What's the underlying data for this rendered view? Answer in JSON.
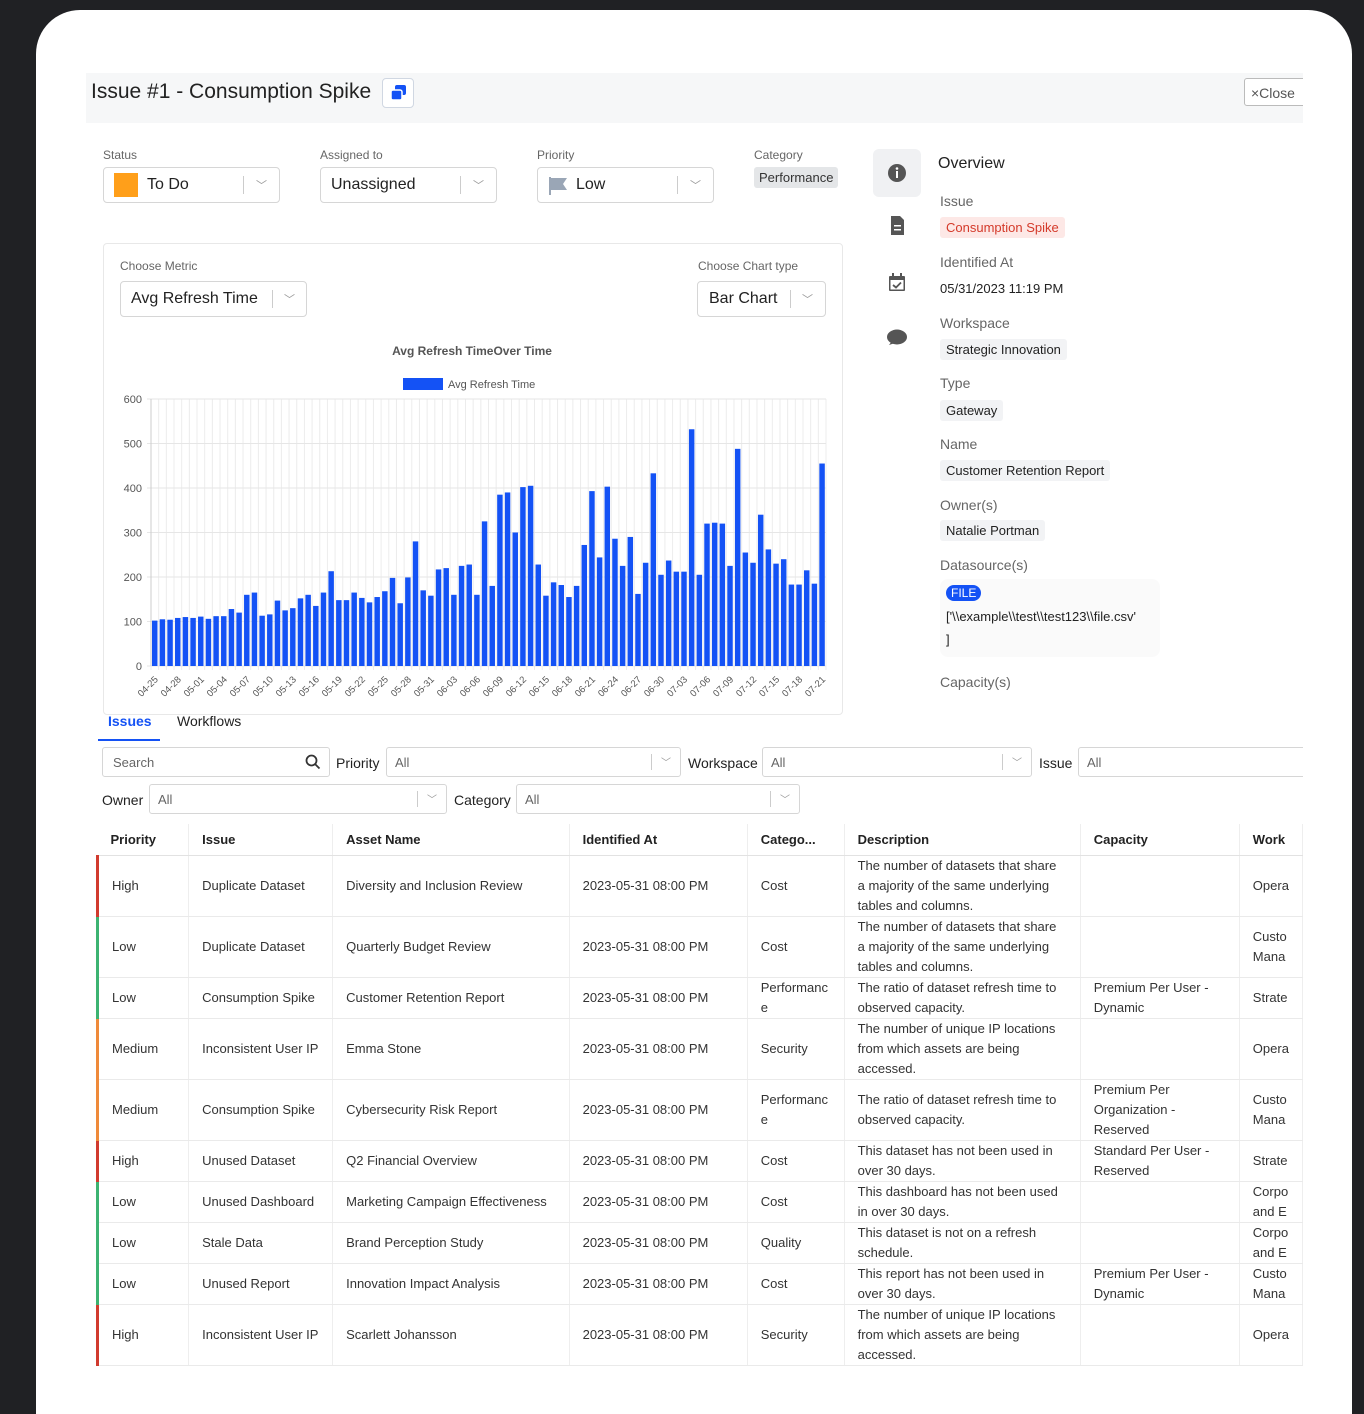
{
  "header": {
    "title": "Issue #1 - Consumption Spike",
    "close_label": "×Close"
  },
  "fields": {
    "status_label": "Status",
    "status_value": "To Do",
    "assigned_label": "Assigned to",
    "assigned_value": "Unassigned",
    "priority_label": "Priority",
    "priority_value": "Low",
    "category_label": "Category",
    "category_value": "Performance"
  },
  "chart_controls": {
    "metric_label": "Choose Metric",
    "metric_value": "Avg Refresh Time",
    "type_label": "Choose Chart type",
    "type_value": "Bar Chart"
  },
  "chart_data": {
    "type": "bar",
    "title": "Avg Refresh TimeOver Time",
    "legend": "Avg Refresh Time",
    "ylim": [
      0,
      600
    ],
    "yticks": [
      0,
      100,
      200,
      300,
      400,
      500,
      600
    ],
    "color": "#1452f5",
    "xtick_labels": [
      "04-25",
      "04-28",
      "05-01",
      "05-04",
      "05-07",
      "05-10",
      "05-13",
      "05-16",
      "05-19",
      "05-22",
      "05-25",
      "05-28",
      "05-31",
      "06-03",
      "06-06",
      "06-09",
      "06-12",
      "06-15",
      "06-18",
      "06-21",
      "06-24",
      "06-27",
      "06-30",
      "07-03",
      "07-06",
      "07-09",
      "07-12",
      "07-15",
      "07-18",
      "07-21"
    ],
    "values": [
      102,
      105,
      104,
      108,
      110,
      108,
      111,
      106,
      112,
      112,
      128,
      120,
      160,
      165,
      113,
      116,
      147,
      125,
      130,
      152,
      160,
      135,
      165,
      213,
      148,
      148,
      165,
      153,
      143,
      155,
      168,
      198,
      141,
      199,
      280,
      170,
      158,
      217,
      220,
      160,
      225,
      228,
      160,
      325,
      180,
      385,
      390,
      300,
      402,
      405,
      228,
      158,
      188,
      182,
      155,
      180,
      272,
      393,
      244,
      403,
      286,
      225,
      290,
      162,
      232,
      433,
      205,
      237,
      212,
      212,
      532,
      205,
      320,
      322,
      320,
      225,
      488,
      255,
      232,
      340,
      262,
      230,
      240,
      183,
      183,
      215,
      185,
      455
    ]
  },
  "overview": {
    "title": "Overview",
    "issue_label": "Issue",
    "issue_value": "Consumption Spike",
    "identified_label": "Identified At",
    "identified_value": "05/31/2023 11:19 PM",
    "workspace_label": "Workspace",
    "workspace_value": "Strategic Innovation",
    "type_label": "Type",
    "type_value": "Gateway",
    "name_label": "Name",
    "name_value": "Customer Retention Report",
    "owners_label": "Owner(s)",
    "owners_value": "Natalie Portman",
    "datasource_label": "Datasource(s)",
    "datasource_badge": "FILE",
    "datasource_value": "['\\\\example\\\\test\\\\test123\\\\file.csv'",
    "datasource_close": "]",
    "capacity_label": "Capacity(s)"
  },
  "tabs": {
    "issues": "Issues",
    "workflows": "Workflows"
  },
  "filters": {
    "search_placeholder": "Search",
    "priority_label": "Priority",
    "priority_value": "All",
    "workspace_label": "Workspace",
    "workspace_value": "All",
    "issue_label": "Issue",
    "issue_value": "All",
    "owner_label": "Owner",
    "owner_value": "All",
    "category_label": "Category",
    "category_value": "All"
  },
  "table": {
    "columns": [
      "Priority",
      "Issue",
      "Asset Name",
      "Identified At",
      "Catego...",
      "Description",
      "Capacity",
      "Work"
    ],
    "rows": [
      {
        "priority": "High",
        "issue": "Duplicate Dataset",
        "asset": "Diversity and Inclusion Review",
        "identified": "2023-05-31 08:00 PM",
        "category": "Cost",
        "description": "The number of datasets that share a majority of the same underlying tables and columns.",
        "capacity": "",
        "workspace": "Opera"
      },
      {
        "priority": "Low",
        "issue": "Duplicate Dataset",
        "asset": "Quarterly Budget Review",
        "identified": "2023-05-31 08:00 PM",
        "category": "Cost",
        "description": "The number of datasets that share a majority of the same underlying tables and columns.",
        "capacity": "",
        "workspace": "Custo Mana"
      },
      {
        "priority": "Low",
        "issue": "Consumption Spike",
        "asset": "Customer Retention Report",
        "identified": "2023-05-31 08:00 PM",
        "category": "Performanc e",
        "description": "The ratio of dataset refresh time to observed capacity.",
        "capacity": "Premium Per User - Dynamic",
        "workspace": "Strate"
      },
      {
        "priority": "Medium",
        "issue": "Inconsistent User IP",
        "asset": "Emma Stone",
        "identified": "2023-05-31 08:00 PM",
        "category": "Security",
        "description": "The number of unique IP locations from which assets are being accessed.",
        "capacity": "",
        "workspace": "Opera"
      },
      {
        "priority": "Medium",
        "issue": "Consumption Spike",
        "asset": "Cybersecurity Risk Report",
        "identified": "2023-05-31 08:00 PM",
        "category": "Performanc e",
        "description": "The ratio of dataset refresh time to observed capacity.",
        "capacity": "Premium Per Organization - Reserved",
        "workspace": "Custo Mana"
      },
      {
        "priority": "High",
        "issue": "Unused Dataset",
        "asset": "Q2 Financial Overview",
        "identified": "2023-05-31 08:00 PM",
        "category": "Cost",
        "description": "This dataset has not been used in over 30 days.",
        "capacity": "Standard Per User - Reserved",
        "workspace": "Strate"
      },
      {
        "priority": "Low",
        "issue": "Unused Dashboard",
        "asset": "Marketing Campaign Effectiveness",
        "identified": "2023-05-31 08:00 PM",
        "category": "Cost",
        "description": "This dashboard has not been used in over 30 days.",
        "capacity": "",
        "workspace": "Corpo and E"
      },
      {
        "priority": "Low",
        "issue": "Stale Data",
        "asset": "Brand Perception Study",
        "identified": "2023-05-31 08:00 PM",
        "category": "Quality",
        "description": "This dataset is not on a refresh schedule.",
        "capacity": "",
        "workspace": "Corpo and E"
      },
      {
        "priority": "Low",
        "issue": "Unused Report",
        "asset": "Innovation Impact Analysis",
        "identified": "2023-05-31 08:00 PM",
        "category": "Cost",
        "description": "This report has not been used in over 30 days.",
        "capacity": "Premium Per User - Dynamic",
        "workspace": "Custo Mana"
      },
      {
        "priority": "High",
        "issue": "Inconsistent User IP",
        "asset": "Scarlett Johansson",
        "identified": "2023-05-31 08:00 PM",
        "category": "Security",
        "description": "The number of unique IP locations from which assets are being accessed.",
        "capacity": "",
        "workspace": "Opera"
      }
    ]
  },
  "colors": {
    "high": "#d13b2f",
    "medium": "#ef8a3a",
    "low": "#3cb371",
    "accent": "#1452f5",
    "status": "#ff9f1a"
  }
}
